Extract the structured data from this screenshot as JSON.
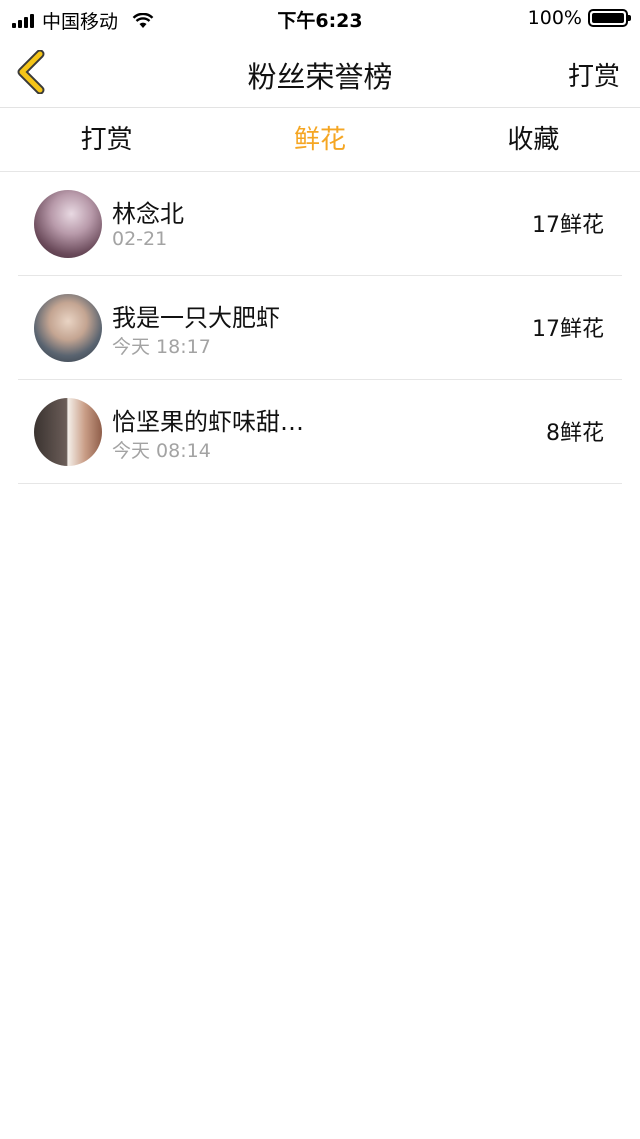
{
  "status_bar": {
    "carrier": "中国移动",
    "time": "下午6:23",
    "battery": "100%",
    "battery_level": 1.0
  },
  "nav": {
    "title": "粉丝荣誉榜",
    "right_action": "打赏",
    "back_icon": "chevron-left-icon",
    "accent_color": "#f5c518"
  },
  "tabs": [
    {
      "label": "打赏",
      "active": false
    },
    {
      "label": "鲜花",
      "active": true
    },
    {
      "label": "收藏",
      "active": false
    }
  ],
  "active_color": "#f5a623",
  "list": [
    {
      "name": "林念北",
      "time": "02-21",
      "amount": "17鲜花"
    },
    {
      "name": "我是一只大肥虾",
      "time": "今天 18:17",
      "amount": "17鲜花"
    },
    {
      "name": "恰坚果的虾味甜…",
      "time": "今天 08:14",
      "amount": "8鲜花"
    }
  ]
}
